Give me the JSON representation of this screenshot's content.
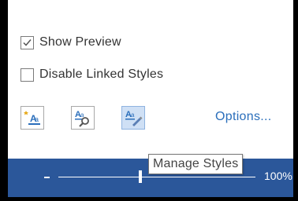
{
  "options": {
    "show_preview": {
      "label": "Show Preview",
      "checked": true
    },
    "disable_linked_styles": {
      "label": "Disable Linked Styles",
      "checked": false
    }
  },
  "toolbar": {
    "buttons": [
      {
        "name": "new-style",
        "icon": "new-style-icon",
        "active": false
      },
      {
        "name": "style-inspector",
        "icon": "style-inspector-icon",
        "active": false
      },
      {
        "name": "manage-styles",
        "icon": "manage-styles-icon",
        "active": true
      }
    ],
    "options_link": "Options..."
  },
  "tooltip": {
    "text": "Manage Styles"
  },
  "status_bar": {
    "zoom_text": "100%",
    "zoom_value": 100,
    "color": "#2b579a"
  },
  "colors": {
    "accent": "#2a6ebb",
    "check": "#555555"
  }
}
